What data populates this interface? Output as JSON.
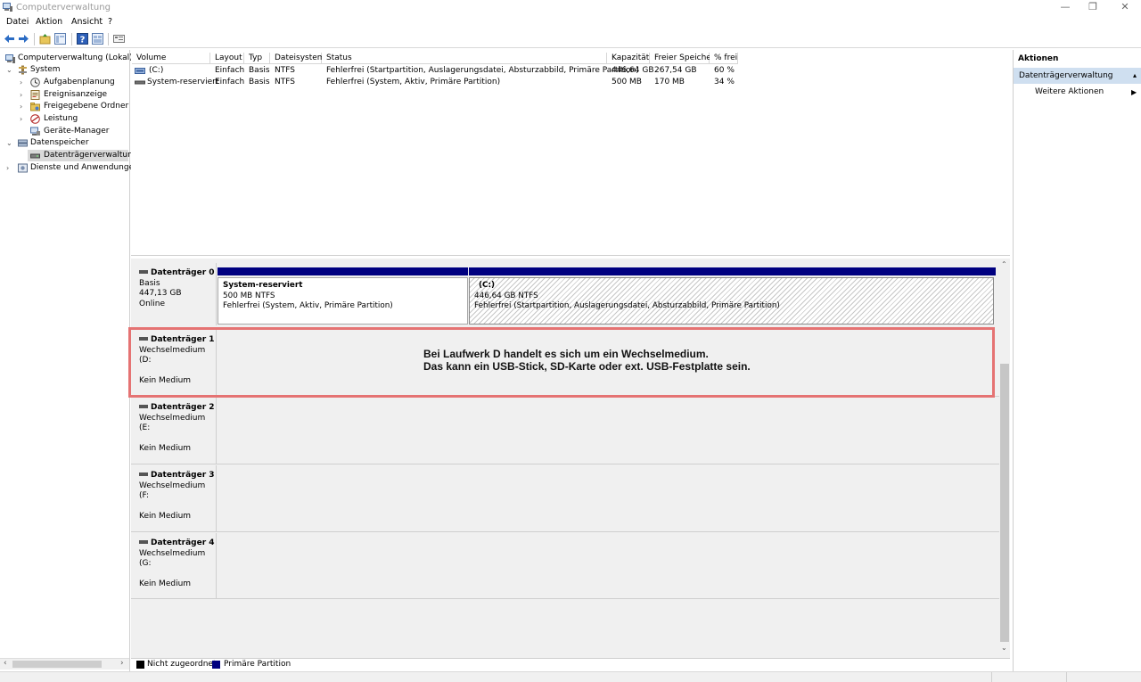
{
  "window": {
    "title": "Computerverwaltung",
    "controls": {
      "minimize": "—",
      "restore": "❐",
      "close": "✕"
    }
  },
  "menu": [
    "Datei",
    "Aktion",
    "Ansicht",
    "?"
  ],
  "tree": {
    "root": "Computerverwaltung (Lokal)",
    "system": "System",
    "aufgaben": "Aufgabenplanung",
    "ereignis": "Ereignisanzeige",
    "freigabe": "Freigegebene Ordner",
    "leistung": "Leistung",
    "geraete": "Geräte-Manager",
    "datenspeicher": "Datenspeicher",
    "datentraeger": "Datenträgerverwaltung",
    "dienste": "Dienste und Anwendungen"
  },
  "volumes": {
    "headers": [
      "Volume",
      "Layout",
      "Typ",
      "Dateisystem",
      "Status",
      "Kapazität",
      "Freier Speicher",
      "% frei"
    ],
    "rows": [
      [
        "(C:)",
        "Einfach",
        "Basis",
        "NTFS",
        "Fehlerfrei (Startpartition, Auslagerungsdatei, Absturzabbild, Primäre Partition)",
        "446,64 GB",
        "267,54 GB",
        "60 %"
      ],
      [
        "System-reserviert",
        "Einfach",
        "Basis",
        "NTFS",
        "Fehlerfrei (System, Aktiv, Primäre Partition)",
        "500 MB",
        "170 MB",
        "34 %"
      ]
    ]
  },
  "disks": {
    "d0": {
      "name": "Datenträger 0",
      "type": "Basis",
      "size": "447,13 GB",
      "status": "Online"
    },
    "d1": {
      "name": "Datenträger 1",
      "type": "Wechselmedium (D:",
      "status": "Kein Medium"
    },
    "d2": {
      "name": "Datenträger 2",
      "type": "Wechselmedium (E:",
      "status": "Kein Medium"
    },
    "d3": {
      "name": "Datenträger 3",
      "type": "Wechselmedium (F:",
      "status": "Kein Medium"
    },
    "d4": {
      "name": "Datenträger 4",
      "type": "Wechselmedium (G:",
      "status": "Kein Medium"
    }
  },
  "partitions": {
    "sysres": {
      "name": "System-reserviert",
      "size": "500 MB NTFS",
      "status": "Fehlerfrei (System, Aktiv, Primäre Partition)"
    },
    "c": {
      "name": "(C:)",
      "size": "446,64 GB NTFS",
      "status": "Fehlerfrei (Startpartition, Auslagerungsdatei, Absturzabbild, Primäre Partition)"
    }
  },
  "annotation": {
    "line1": "Bei Laufwerk D handelt es sich um ein Wechselmedium.",
    "line2": "Das kann ein USB-Stick, SD-Karte oder ext. USB-Festplatte sein."
  },
  "legend": {
    "unallocated": "Nicht zugeordnet",
    "primary": "Primäre Partition",
    "colors": {
      "unallocated": "#000000",
      "primary": "#000080"
    }
  },
  "actions": {
    "title": "Aktionen",
    "section": "Datenträgerverwaltung",
    "more": "Weitere Aktionen"
  },
  "colors": {
    "selection": "#cfdff0",
    "annotation": "#e57373",
    "primary": "#000080"
  }
}
